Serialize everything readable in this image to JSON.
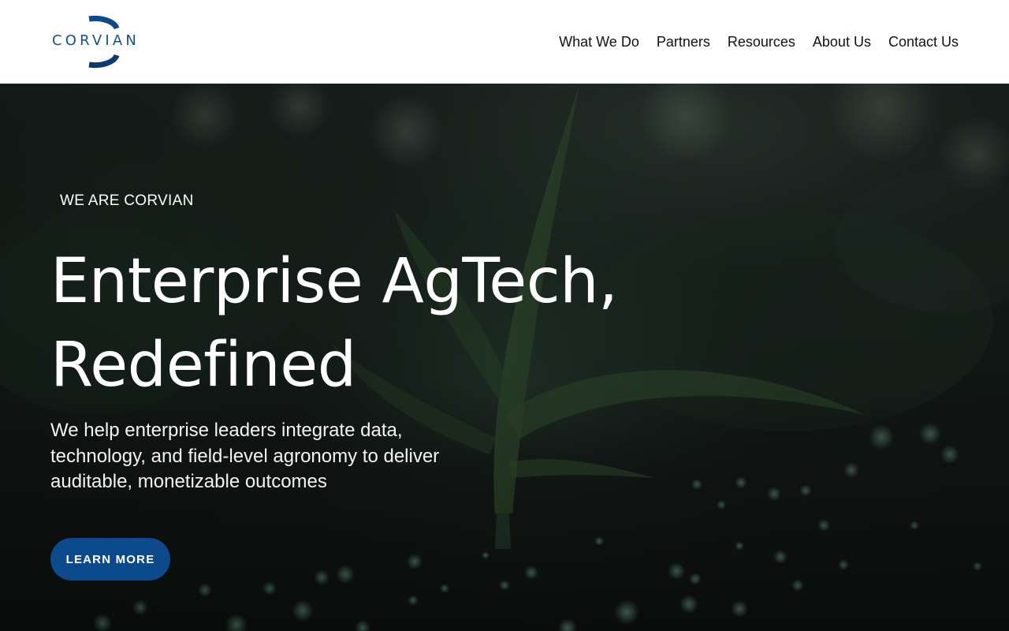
{
  "brand": {
    "name": "CORVIAN",
    "primary_color": "#0d4a8c",
    "logo_text_color": "#1a4e8a"
  },
  "nav": {
    "items": [
      {
        "label": "What We Do",
        "name": "nav-what-we-do"
      },
      {
        "label": "Partners",
        "name": "nav-partners"
      },
      {
        "label": "Resources",
        "name": "nav-resources"
      },
      {
        "label": "About Us",
        "name": "nav-about-us"
      },
      {
        "label": "Contact Us",
        "name": "nav-contact-us"
      }
    ]
  },
  "hero": {
    "eyebrow": "WE ARE CORVIAN",
    "headline_line1": "Enterprise AgTech,",
    "headline_line2": "Redefined",
    "subtitle": "We help enterprise leaders integrate data, technology, and field-level agronomy to deliver auditable, monetizable outcomes",
    "cta_label": "LEARN MORE",
    "background_image": "young-corn-plant-in-soil"
  }
}
